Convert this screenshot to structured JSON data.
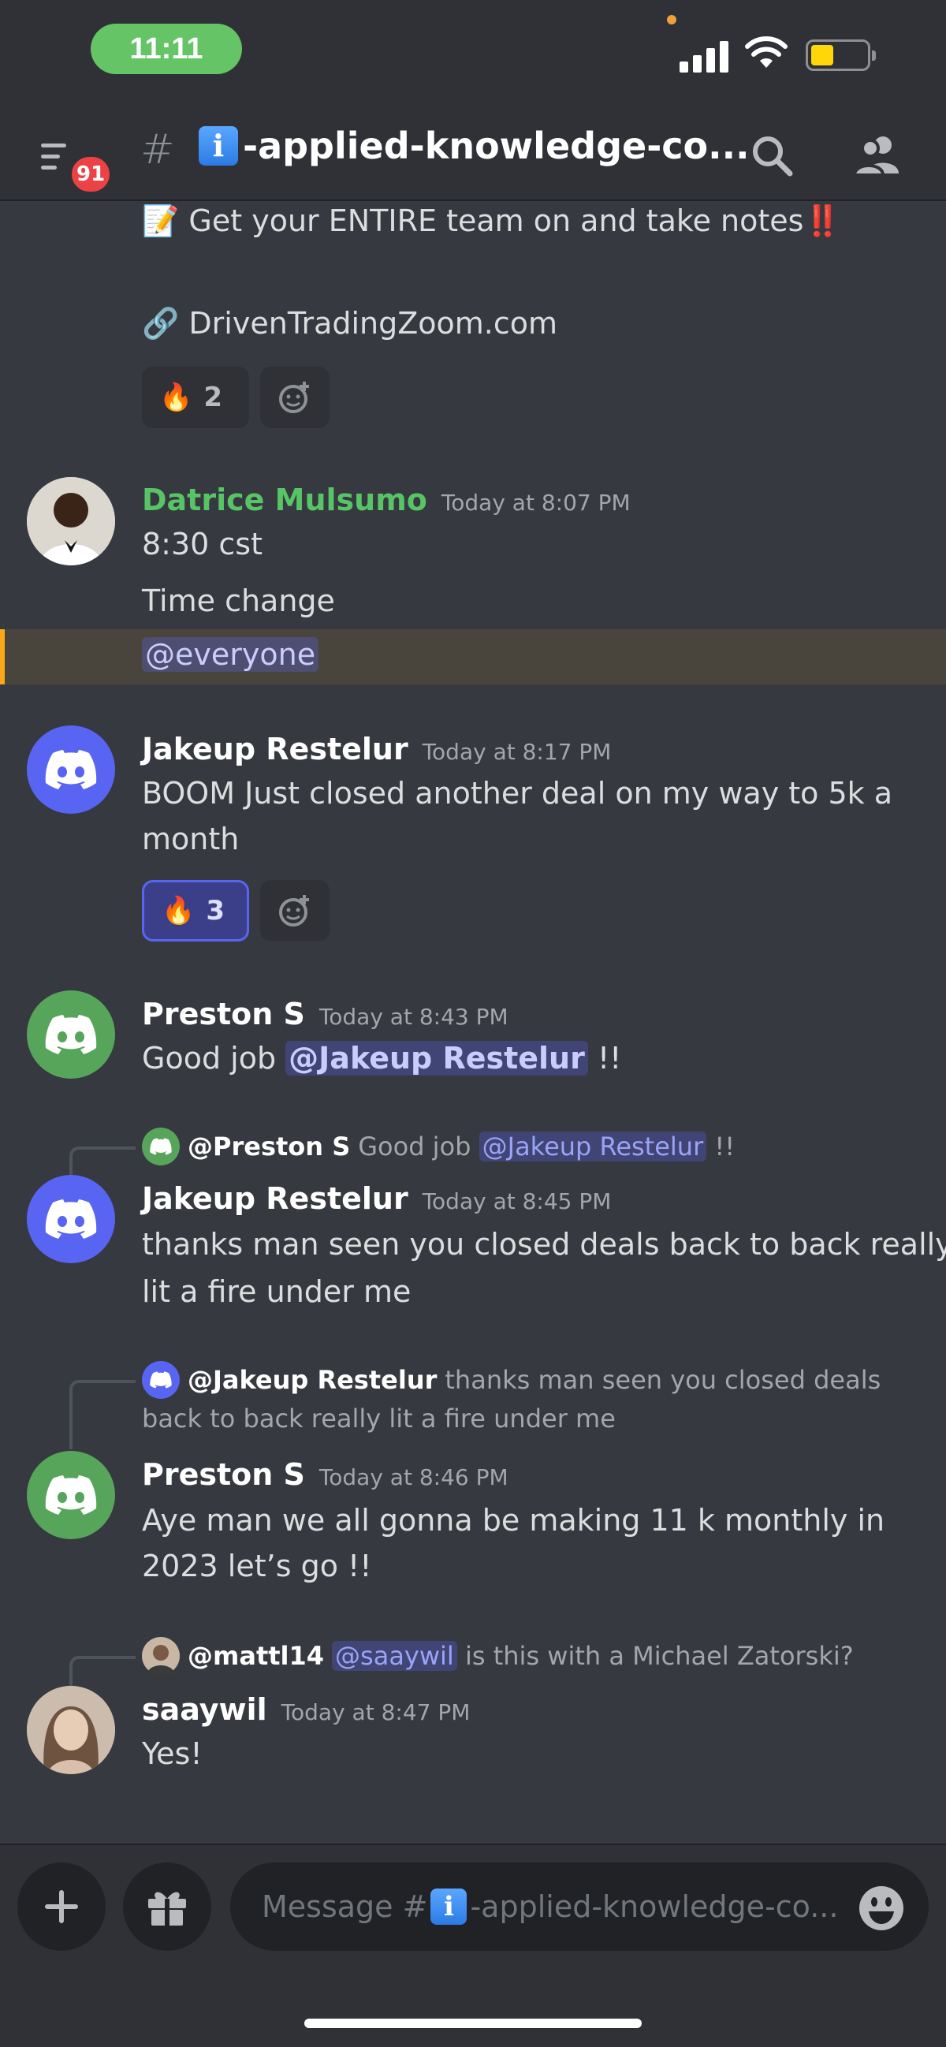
{
  "status_bar": {
    "time": "11:11"
  },
  "header": {
    "notification_count": "91",
    "channel_hash": "#",
    "channel_emoji": "i",
    "channel_name": "-applied-knowledge-co..."
  },
  "messages": {
    "top_line1": "Get your ENTIRE team on and take notes",
    "top_line1_suffix": "‼️",
    "top_line2": "DrivenTradingZoom.com",
    "reaction1_count": "2",
    "m1": {
      "author": "Datrice Mulsumo",
      "author_color": "#57c566",
      "time": "Today at 8:07 PM",
      "line1": "8:30 cst",
      "line2": "Time change",
      "mention": "@everyone"
    },
    "m2": {
      "author": "Jakeup Restelur",
      "time": "Today at 8:17 PM",
      "line1": "BOOM Just closed another deal on my way to 5k a",
      "line2": "month",
      "reaction_count": "3"
    },
    "m3": {
      "author": "Preston S",
      "time": "Today at 8:43 PM",
      "text_before": "Good job ",
      "mention": "@Jakeup Restelur",
      "text_after": " !!"
    },
    "m4": {
      "reply_author": "@Preston S",
      "reply_text_before": "Good job ",
      "reply_mention": "@Jakeup Restelur",
      "reply_text_after": " !!",
      "author": "Jakeup Restelur",
      "time": "Today at 8:45 PM",
      "line1": "thanks man seen you closed deals back to back really",
      "line2": "lit a fire under me"
    },
    "m5": {
      "reply_author": "@Jakeup Restelur",
      "reply_line1": "thanks man seen you closed deals",
      "reply_line2": "back to back really lit a fire under me",
      "author": "Preston S",
      "time": "Today at 8:46 PM",
      "line1": "Aye man we all gonna be making 11 k monthly in",
      "line2": "2023 let’s go !!"
    },
    "m6": {
      "reply_author": "@mattl14",
      "reply_mention": "@saaywil",
      "reply_text": " is this with a Michael Zatorski?",
      "author": "saaywil",
      "time": "Today at 8:47 PM",
      "line1": "Yes!"
    }
  },
  "composer": {
    "placeholder_prefix": "Message #",
    "placeholder_suffix": "-applied-knowledge-co..."
  },
  "colors": {
    "blurple": "#5865f2",
    "green_avatar": "#57a55b",
    "mention_bg": "#3b3f8a",
    "highlight_bar": "#faa81a"
  }
}
